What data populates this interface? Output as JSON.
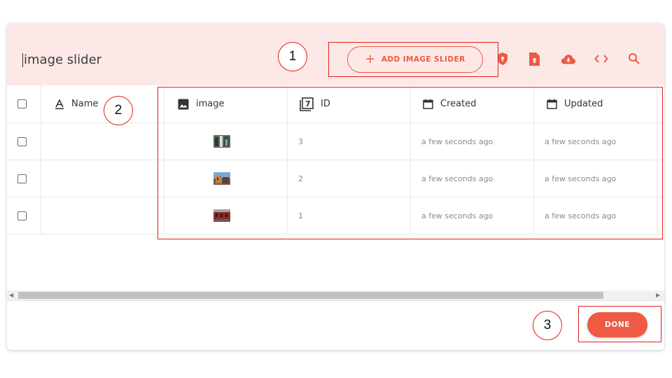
{
  "dialog": {
    "title": "image slider",
    "add_button_label": "ADD IMAGE SLIDER",
    "header_icons": [
      "shield-lock-icon",
      "file-upload-icon",
      "cloud-download-icon",
      "code-icon",
      "search-icon"
    ],
    "accent_color": "#ee5a43",
    "header_bg": "#fce9e7"
  },
  "table": {
    "columns": [
      {
        "label": "Name",
        "icon": "text-field-icon"
      },
      {
        "label": "image",
        "icon": "image-icon"
      },
      {
        "label": "ID",
        "icon": "number-icon",
        "icon_glyph": "7"
      },
      {
        "label": "Created",
        "icon": "calendar-icon"
      },
      {
        "label": "Updated",
        "icon": "calendar-icon"
      }
    ],
    "rows": [
      {
        "name": "",
        "id": "3",
        "created": "a few seconds ago",
        "updated": "a few seconds ago"
      },
      {
        "name": "",
        "id": "2",
        "created": "a few seconds ago",
        "updated": "a few seconds ago"
      },
      {
        "name": "",
        "id": "1",
        "created": "a few seconds ago",
        "updated": "a few seconds ago"
      }
    ]
  },
  "footer": {
    "done_label": "DONE"
  },
  "annotations": [
    "1",
    "2",
    "3"
  ]
}
